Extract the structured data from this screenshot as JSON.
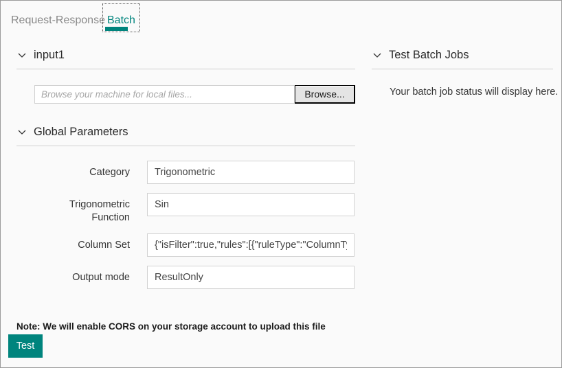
{
  "tabs": [
    {
      "label": "Request-Response",
      "active": false
    },
    {
      "label": "Batch",
      "active": true
    }
  ],
  "left": {
    "input_section": {
      "title": "input1",
      "chevron_icon": "chevron-down-icon",
      "file_placeholder": "Browse your machine for local files...",
      "file_value": "",
      "browse_label": "Browse..."
    },
    "params_section": {
      "title": "Global Parameters",
      "chevron_icon": "chevron-down-icon",
      "rows": [
        {
          "label": "Category",
          "value": "Trigonometric"
        },
        {
          "label": "Trigonometric\nFunction",
          "value": "Sin"
        },
        {
          "label": "Column Set",
          "value": "{\"isFilter\":true,\"rules\":[{\"ruleType\":\"ColumnType\""
        },
        {
          "label": "Output mode",
          "value": "ResultOnly"
        }
      ]
    },
    "note": "Note: We will enable CORS on your storage account to upload this file",
    "test_label": "Test"
  },
  "right": {
    "title": "Test Batch Jobs",
    "chevron_icon": "chevron-down-icon",
    "status_text": "Your batch job status will display here."
  },
  "colors": {
    "accent": "#00847d",
    "page_background": "#fafafa",
    "border": "#9a9a9a",
    "muted_text": "#8a8a8a"
  }
}
